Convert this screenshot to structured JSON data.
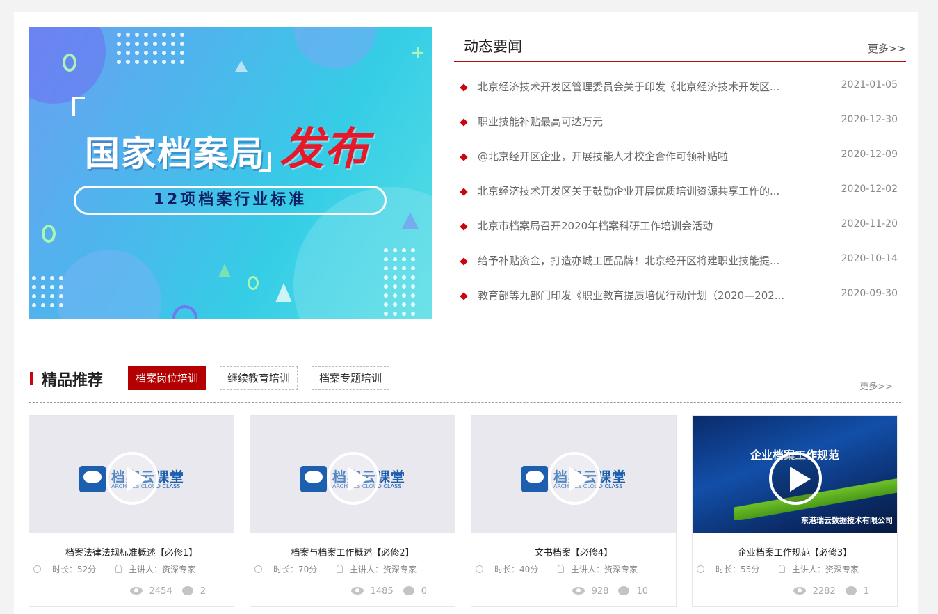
{
  "banner": {
    "title": "国家档案局",
    "highlight": "发布",
    "subtitle": "12项档案行业标准"
  },
  "news": {
    "title": "动态要闻",
    "more": "更多>>",
    "items": [
      {
        "title": "北京经济技术开发区管理委员会关于印发《北京经济技术开发区...",
        "date": "2021-01-05"
      },
      {
        "title": "职业技能补贴最高可达万元",
        "date": "2020-12-30"
      },
      {
        "title": "@北京经开区企业，开展技能人才校企合作可领补贴啦",
        "date": "2020-12-09"
      },
      {
        "title": "北京经济技术开发区关于鼓励企业开展优质培训资源共享工作的...",
        "date": "2020-12-02"
      },
      {
        "title": "北京市档案局召开2020年档案科研工作培训会活动",
        "date": "2020-11-20"
      },
      {
        "title": "给予补贴资金，打造亦城工匠品牌！北京经开区将建职业技能提...",
        "date": "2020-10-14"
      },
      {
        "title": "教育部等九部门印发《职业教育提质培优行动计划（2020—202...",
        "date": "2020-09-30"
      }
    ]
  },
  "recommend": {
    "title": "精品推荐",
    "more": "更多>>",
    "tabs": [
      {
        "label": "档案岗位培训",
        "active": true
      },
      {
        "label": "继续教育培训",
        "active": false
      },
      {
        "label": "档案专题培训",
        "active": false
      }
    ]
  },
  "logo": {
    "name": "档案云课堂",
    "sub": "ARCHIVES CLOUD CLASS"
  },
  "courses": [
    {
      "title": "档案法律法规标准概述【必修1】",
      "duration": "时长：52分",
      "speaker": "主讲人：资深专家",
      "views": "2454",
      "comments": "2"
    },
    {
      "title": "档案与档案工作概述【必修2】",
      "duration": "时长：70分",
      "speaker": "主讲人：资深专家",
      "views": "1485",
      "comments": "0"
    },
    {
      "title": "文书档案【必修4】",
      "duration": "时长：40分",
      "speaker": "主讲人：资深专家",
      "views": "928",
      "comments": "10"
    },
    {
      "title": "企业档案工作规范【必修3】",
      "duration": "时长：55分",
      "speaker": "主讲人：资深专家",
      "views": "2282",
      "comments": "1",
      "video_title": "企业档案工作规范",
      "video_company": "东港瑞云数据技术有限公司"
    }
  ]
}
